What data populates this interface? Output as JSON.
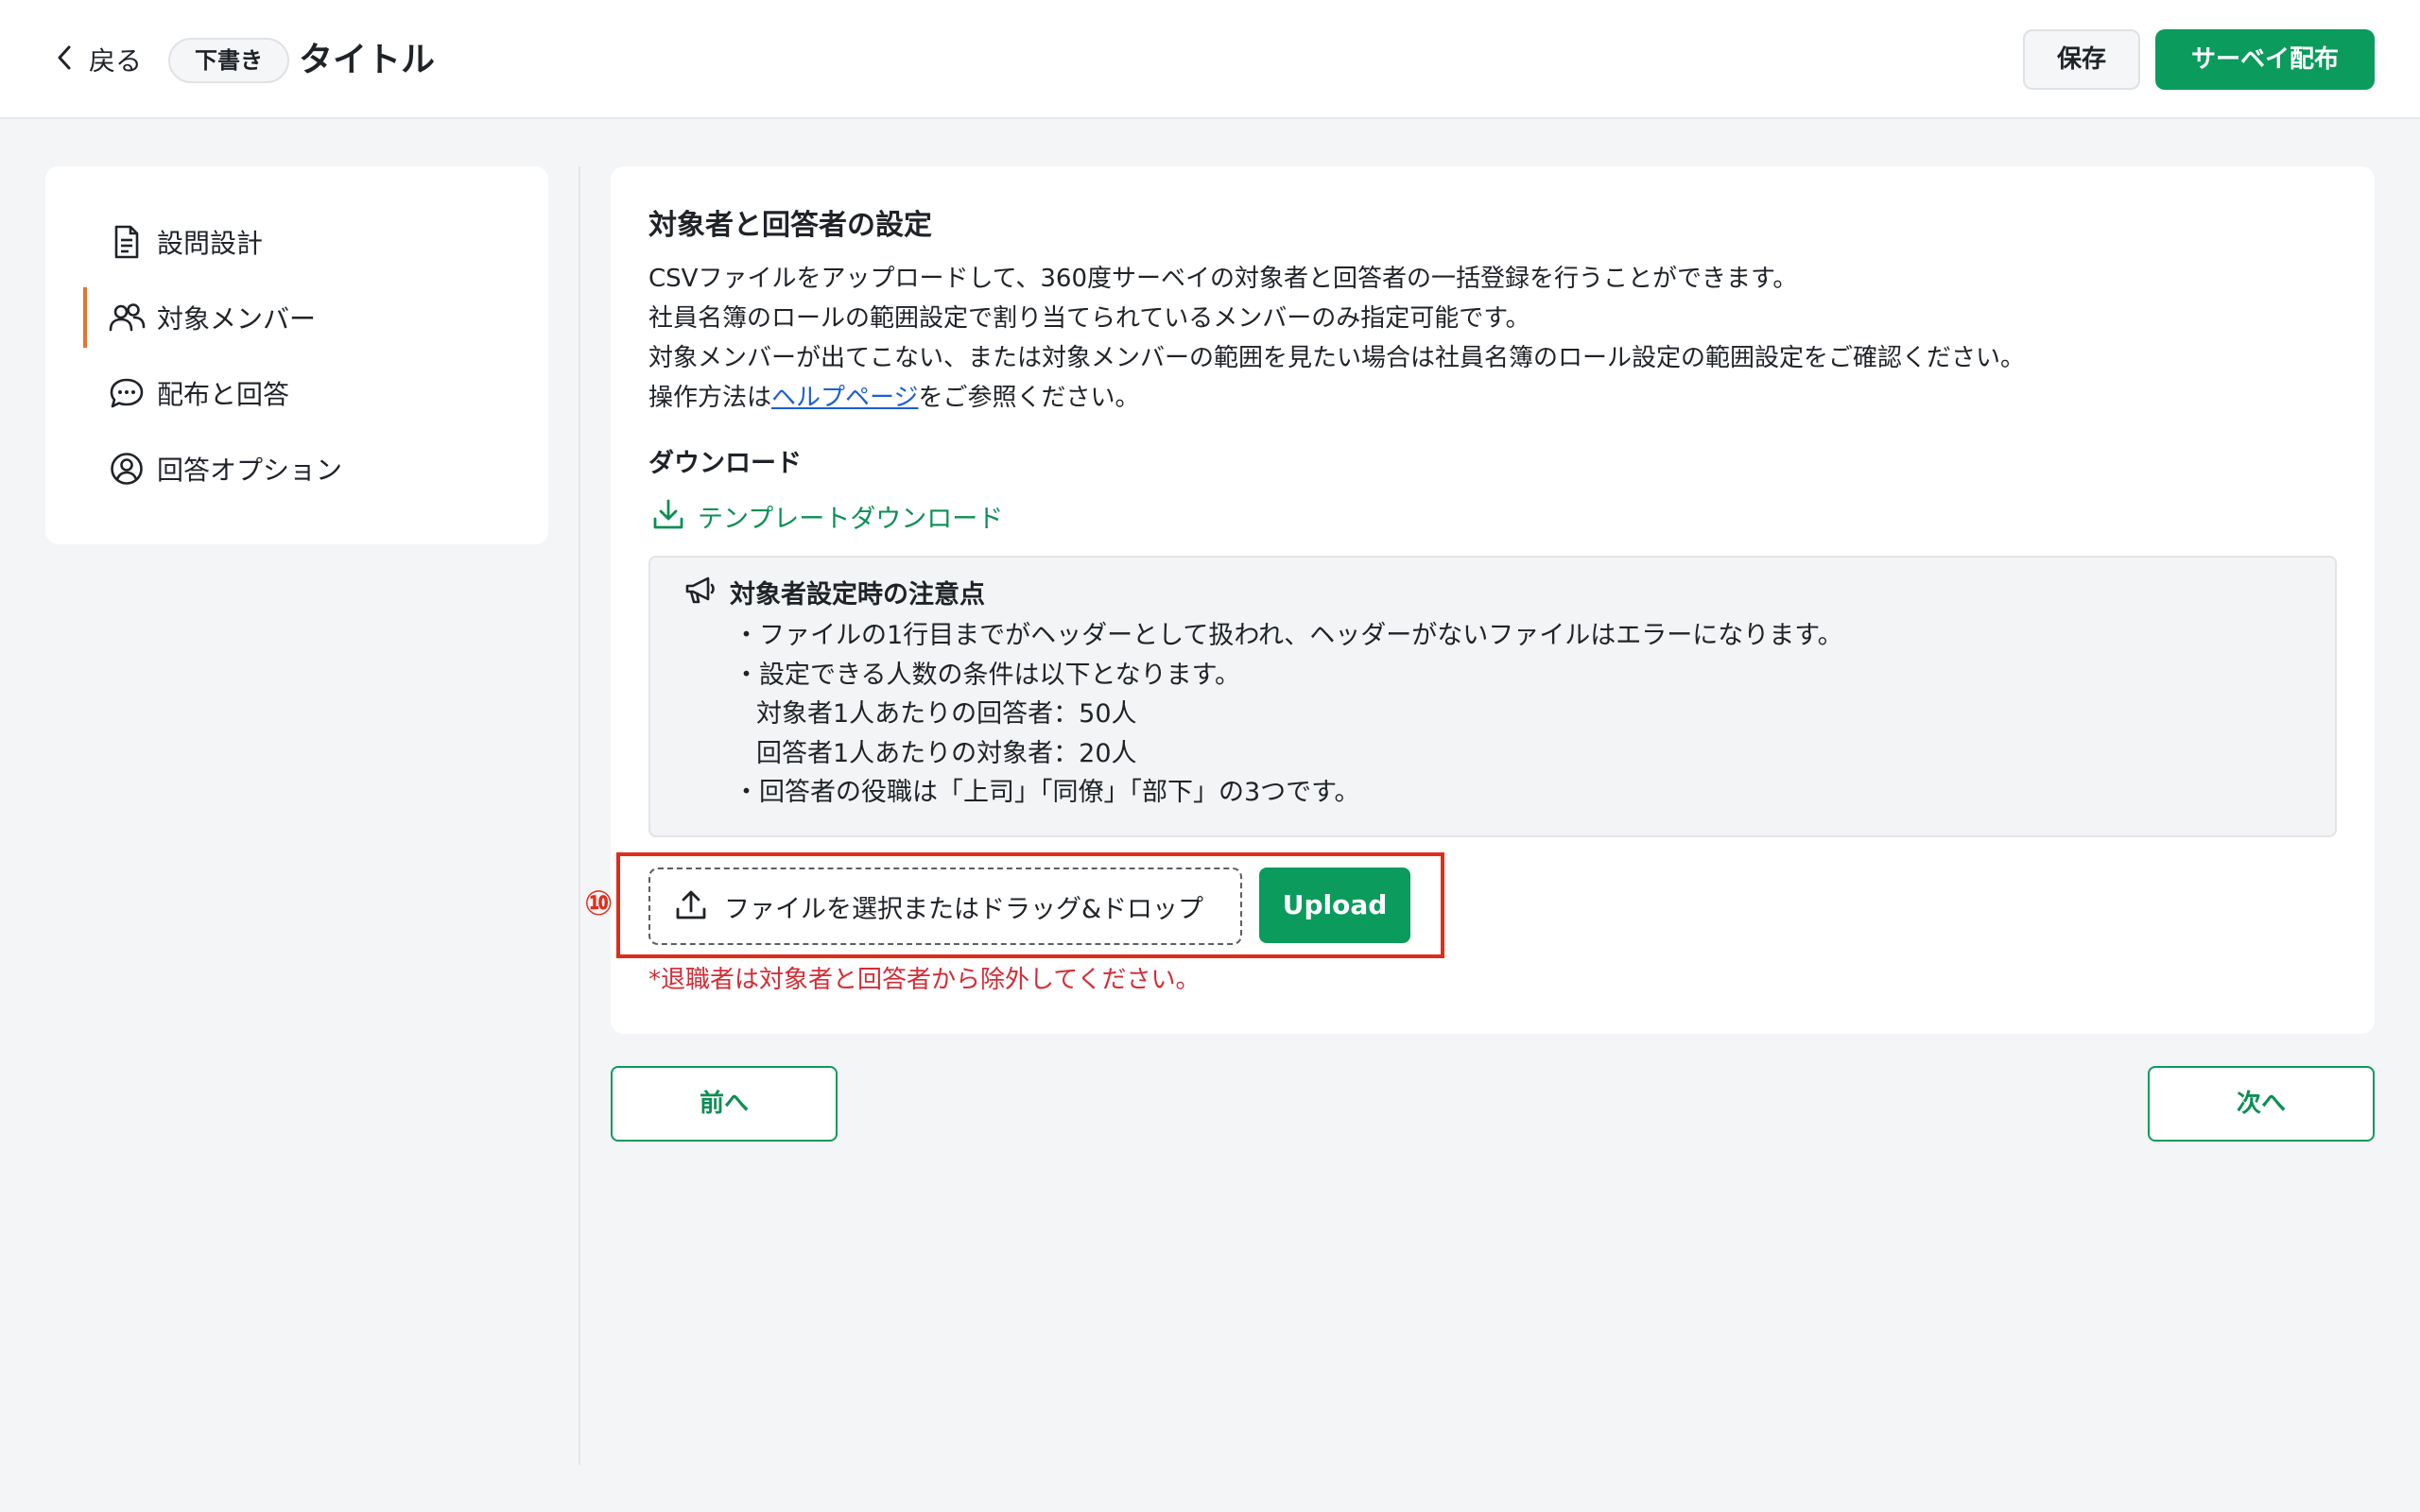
{
  "header": {
    "back_label": "戻る",
    "status_badge": "下書き",
    "title": "タイトル",
    "save_label": "保存",
    "distribute_label": "サーベイ配布"
  },
  "sidebar": {
    "items": [
      {
        "label": "設問設計",
        "icon": "document-icon"
      },
      {
        "label": "対象メンバー",
        "icon": "users-icon",
        "active": true
      },
      {
        "label": "配布と回答",
        "icon": "chat-icon"
      },
      {
        "label": "回答オプション",
        "icon": "user-circle-icon"
      }
    ]
  },
  "main": {
    "heading": "対象者と回答者の設定",
    "description": {
      "line1": "CSVファイルをアップロードして、360度サーベイの対象者と回答者の一括登録を行うことができます。",
      "line2": "社員名簿のロールの範囲設定で割り当てられているメンバーのみ指定可能です。",
      "line3": "対象メンバーが出てこない、または対象メンバーの範囲を見たい場合は社員名簿のロール設定の範囲設定をご確認ください。",
      "line4_prefix": "操作方法は",
      "line4_link": "ヘルプページ",
      "line4_suffix": "をご参照ください。"
    },
    "download_heading": "ダウンロード",
    "template_download_label": "テンプレートダウンロード",
    "notice": {
      "title": "対象者設定時の注意点",
      "items": [
        "・ファイルの1行目までがヘッダーとして扱われ、ヘッダーがないファイルはエラーになります。",
        "・設定できる人数の条件は以下となります。",
        "対象者1人あたりの回答者：50人",
        "回答者1人あたりの対象者：20人",
        "・回答者の役職は「上司」「同僚」「部下」の3つです。"
      ]
    },
    "callout_number": "⑩",
    "dropzone_label": "ファイルを選択またはドラッグ&ドロップ",
    "upload_label": "Upload",
    "warning": "*退職者は対象者と回答者から除外してください。"
  },
  "footer": {
    "prev_label": "前へ",
    "next_label": "次へ"
  },
  "colors": {
    "primary": "#0b9b5c",
    "active_indicator": "#e8722e",
    "highlight": "#e02d1a",
    "warning_text": "#d52c35",
    "link": "#1a5fd6"
  }
}
